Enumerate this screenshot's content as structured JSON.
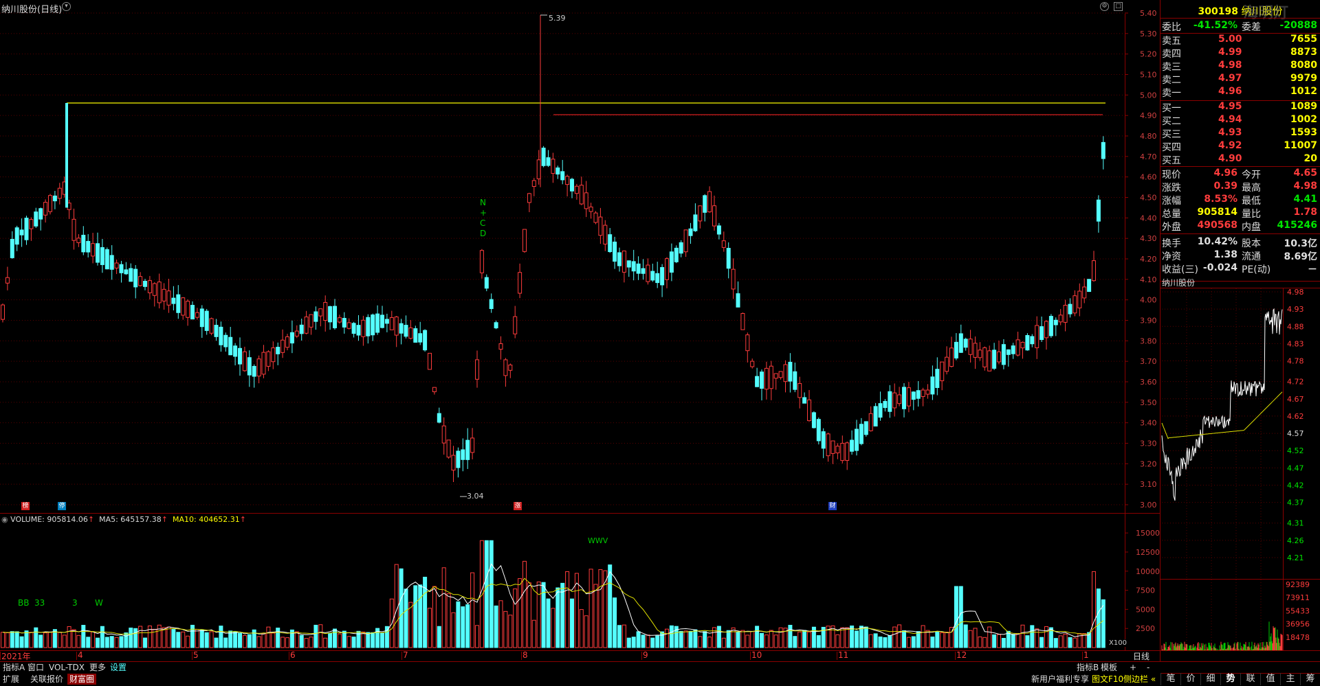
{
  "header": {
    "stock_title": "纳川股份(日线)",
    "vol_line": "VOLUME: 905814.06",
    "ma5_text": "MA5: 645157.38",
    "ma10_text": "MA10: 404652.31",
    "watermark": "海明灯"
  },
  "price_axis": [
    "5.40",
    "5.30",
    "5.20",
    "5.10",
    "5.00",
    "4.90",
    "4.80",
    "4.70",
    "4.60",
    "4.50",
    "4.40",
    "4.30",
    "4.20",
    "4.10",
    "4.00",
    "3.90",
    "3.80",
    "3.70",
    "3.60",
    "3.50",
    "3.40",
    "3.30",
    "3.20",
    "3.10",
    "3.00"
  ],
  "vol_axis": [
    "15000",
    "12500",
    "10000",
    "7500",
    "5000",
    "2500"
  ],
  "vol_unit": "X100",
  "annotations": {
    "high": "5.39",
    "low": "3.04",
    "ncd": [
      "N",
      "+",
      "C",
      "D"
    ],
    "wwv": "WWV",
    "bb": "BB",
    "n33": "33",
    "n3": "3",
    "w": "W",
    "marker1": "榜",
    "marker2": "停",
    "marker3": "涨",
    "marker4": "财"
  },
  "date_axis": [
    "2021年",
    "4",
    "5",
    "6",
    "7",
    "8",
    "9",
    "10",
    "11",
    "12",
    "1"
  ],
  "period_label": "日线",
  "quote": {
    "code": "300198",
    "name": "纳川股份",
    "weibi_label": "委比",
    "weibi": "-41.52%",
    "weicha_label": "委差",
    "weicha": "-20888",
    "sells": [
      {
        "label": "卖五",
        "price": "5.00",
        "vol": "7655"
      },
      {
        "label": "卖四",
        "price": "4.99",
        "vol": "8873"
      },
      {
        "label": "卖三",
        "price": "4.98",
        "vol": "8080"
      },
      {
        "label": "卖二",
        "price": "4.97",
        "vol": "9979"
      },
      {
        "label": "卖一",
        "price": "4.96",
        "vol": "1012"
      }
    ],
    "buys": [
      {
        "label": "买一",
        "price": "4.95",
        "vol": "1089"
      },
      {
        "label": "买二",
        "price": "4.94",
        "vol": "1002"
      },
      {
        "label": "买三",
        "price": "4.93",
        "vol": "1593"
      },
      {
        "label": "买四",
        "price": "4.92",
        "vol": "11007"
      },
      {
        "label": "买五",
        "price": "4.90",
        "vol": "20"
      }
    ],
    "stats": [
      {
        "l1": "现价",
        "v1": "4.96",
        "l2": "今开",
        "v2": "4.65",
        "c1": "red",
        "c2": "red"
      },
      {
        "l1": "涨跌",
        "v1": "0.39",
        "l2": "最高",
        "v2": "4.98",
        "c1": "red",
        "c2": "red"
      },
      {
        "l1": "涨幅",
        "v1": "8.53%",
        "l2": "最低",
        "v2": "4.41",
        "c1": "red",
        "c2": "grn"
      },
      {
        "l1": "总量",
        "v1": "905814",
        "l2": "量比",
        "v2": "1.78",
        "c1": "yel",
        "c2": "red"
      },
      {
        "l1": "外盘",
        "v1": "490568",
        "l2": "内盘",
        "v2": "415246",
        "c1": "red",
        "c2": "grn"
      },
      {
        "l1": "换手",
        "v1": "10.42%",
        "l2": "股本",
        "v2": "10.3亿",
        "c1": "wht",
        "c2": "wht"
      },
      {
        "l1": "净资",
        "v1": "1.38",
        "l2": "流通",
        "v2": "8.69亿",
        "c1": "wht",
        "c2": "wht"
      },
      {
        "l1": "收益(三)",
        "v1": "-0.024",
        "l2": "PE(动)",
        "v2": "－",
        "c1": "wht",
        "c2": "wht"
      }
    ]
  },
  "mini": {
    "title": "纳川股份",
    "price_axis": [
      "4.98",
      "4.93",
      "4.88",
      "4.83",
      "4.78",
      "4.72",
      "4.67",
      "4.62",
      "4.57",
      "4.52",
      "4.47",
      "4.42",
      "4.37",
      "4.31",
      "4.26",
      "4.21"
    ],
    "vol_axis": [
      "92389",
      "73911",
      "55433",
      "36956",
      "18478"
    ]
  },
  "bottom_left": {
    "row1": [
      "指标A",
      "窗口",
      "VOL-TDX",
      "更多",
      "设置"
    ],
    "row2": [
      "扩展",
      "关联报价",
      "财富圈"
    ]
  },
  "bottom_right": {
    "indicator_b": "指标B",
    "template": "模板",
    "buttons": [
      "+",
      "-"
    ],
    "promo": "新用户福利专享",
    "f10": "图文F10",
    "sidebar": "侧边栏 «"
  },
  "right_tabs": [
    "笔",
    "价",
    "细",
    "势",
    "联",
    "值",
    "主",
    "筹"
  ],
  "colors": {
    "up": "#ff3c3c",
    "down": "#54ffff",
    "ma5": "#ffffff",
    "ma10": "#ffff00",
    "axis": "#8b0000"
  }
}
